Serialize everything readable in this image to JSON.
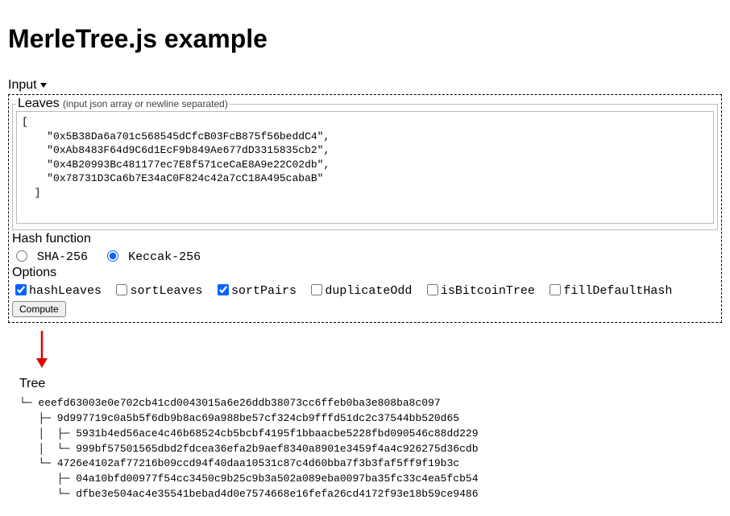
{
  "title": "MerleTree.js example",
  "input_section_label": "Input",
  "leaves": {
    "legend": "Leaves",
    "hint": "(input json array or newline separated)",
    "value": "[\n    \"0x5B38Da6a701c568545dCfcB03FcB875f56beddC4\",\n    \"0xAb8483F64d9C6d1EcF9b849Ae677dD3315835cb2\",\n    \"0x4B20993Bc481177ec7E8f571ceCaE8A9e22C02db\",\n    \"0x78731D3Ca6b7E34aC0F824c42a7cC18A495cabaB\"\n  ]"
  },
  "hash": {
    "label": "Hash function",
    "options": [
      {
        "label": "SHA-256",
        "checked": false
      },
      {
        "label": "Keccak-256",
        "checked": true
      }
    ]
  },
  "options": {
    "label": "Options",
    "items": [
      {
        "label": "hashLeaves",
        "checked": true
      },
      {
        "label": "sortLeaves",
        "checked": false
      },
      {
        "label": "sortPairs",
        "checked": true
      },
      {
        "label": "duplicateOdd",
        "checked": false
      },
      {
        "label": "isBitcoinTree",
        "checked": false
      },
      {
        "label": "fillDefaultHash",
        "checked": false
      }
    ]
  },
  "compute_label": "Compute",
  "tree": {
    "label": "Tree",
    "text": "└─ eeefd63003e0e702cb41cd0043015a6e26ddb38073cc6ffeb0ba3e808ba8c097\n   ├─ 9d997719c0a5b5f6db9b8ac69a988be57cf324cb9fffd51dc2c37544bb520d65\n   │  ├─ 5931b4ed56ace4c46b68524cb5bcbf4195f1bbaacbe5228fbd090546c88dd229\n   │  └─ 999bf57501565dbd2fdcea36efa2b9aef8340a8901e3459f4a4c926275d36cdb\n   └─ 4726e4102af77216b09ccd94f40daa10531c87c4d60bba7f3b3faf5ff9f19b3c\n      ├─ 04a10bfd00977f54cc3450c9b25c9b3a502a089eba0097ba35fc33c4ea5fcb54\n      └─ dfbe3e504ac4e35541bebad4d0e7574668e16fefa26cd4172f93e18b59ce9486"
  }
}
